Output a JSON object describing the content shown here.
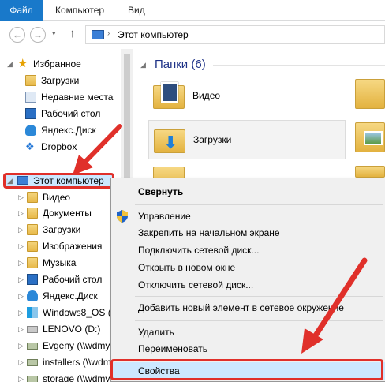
{
  "ribbon": {
    "tabs": [
      "Файл",
      "Компьютер",
      "Вид"
    ]
  },
  "address": {
    "path": "Этот компьютер",
    "separator": "›"
  },
  "navigation": {
    "favorites_label": "Избранное",
    "favorites": [
      {
        "label": "Загрузки",
        "icon": "downloads-folder-icon"
      },
      {
        "label": "Недавние места",
        "icon": "recent-places-icon"
      },
      {
        "label": "Рабочий стол",
        "icon": "desktop-icon"
      },
      {
        "label": "Яндекс.Диск",
        "icon": "cloud-icon"
      },
      {
        "label": "Dropbox",
        "icon": "dropbox-icon"
      }
    ],
    "this_pc_label": "Этот компьютер",
    "this_pc_items": [
      {
        "label": "Видео",
        "icon": "video-folder-icon"
      },
      {
        "label": "Документы",
        "icon": "documents-folder-icon"
      },
      {
        "label": "Загрузки",
        "icon": "downloads-folder-icon"
      },
      {
        "label": "Изображения",
        "icon": "pictures-folder-icon"
      },
      {
        "label": "Музыка",
        "icon": "music-folder-icon"
      },
      {
        "label": "Рабочий стол",
        "icon": "desktop-icon"
      },
      {
        "label": "Яндекс.Диск",
        "icon": "cloud-icon"
      },
      {
        "label": "Windows8_OS (C",
        "icon": "windows-drive-icon"
      },
      {
        "label": "LENOVO (D:)",
        "icon": "drive-icon"
      },
      {
        "label": "Evgeny (\\\\wdmy",
        "icon": "network-drive-icon"
      },
      {
        "label": "installers (\\\\wdm",
        "icon": "network-drive-icon"
      },
      {
        "label": "storage (\\\\wdmy",
        "icon": "network-drive-icon"
      }
    ]
  },
  "content": {
    "group_title": "Папки (6)",
    "tiles": [
      {
        "label": "Видео",
        "icon": "video-folder-icon"
      },
      {
        "label": "Загрузки",
        "icon": "downloads-folder-icon"
      }
    ]
  },
  "context_menu": {
    "items": [
      {
        "label": "Свернуть",
        "bold": true
      },
      {
        "label": "Управление",
        "icon": "shield-icon"
      },
      {
        "label": "Закрепить на начальном экране"
      },
      {
        "label": "Подключить сетевой диск..."
      },
      {
        "label": "Открыть в новом окне"
      },
      {
        "label": "Отключить сетевой диск..."
      },
      {
        "label": "Добавить новый элемент в сетевое окружение"
      },
      {
        "label": "Удалить"
      },
      {
        "label": "Переименовать"
      },
      {
        "label": "Свойства",
        "highlighted": true
      }
    ]
  },
  "colors": {
    "file_tab": "#1979ca",
    "selection": "#cce8ff",
    "annotation_red": "#e0302a",
    "group_title": "#1e3287"
  }
}
